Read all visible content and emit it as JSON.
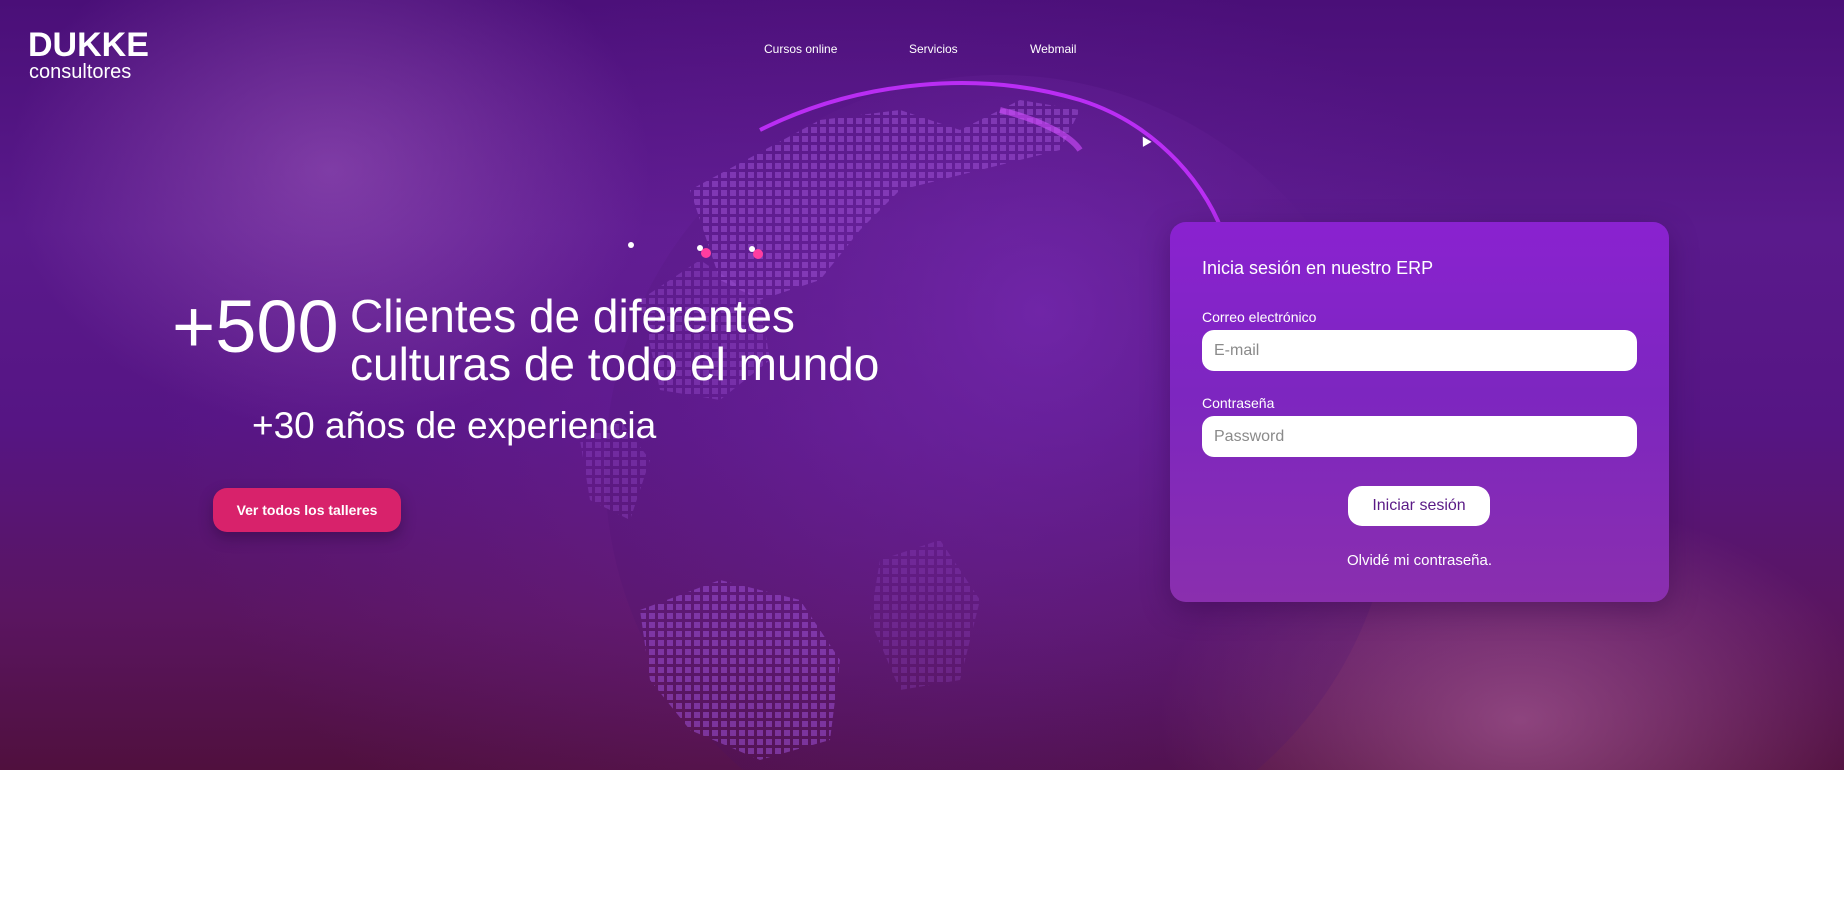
{
  "brand": {
    "line1": "DUKKE",
    "line2": "consultores"
  },
  "nav": {
    "items": [
      "Cursos online",
      "Servicios",
      "Webmail"
    ]
  },
  "hero": {
    "big_number": "+500",
    "headline_line1": "Clientes de diferentes",
    "headline_line2": "culturas de todo el mundo",
    "subline": "+30 años de experiencia",
    "cta_label": "Ver todos los talleres"
  },
  "login": {
    "title": "Inicia sesión en nuestro ERP",
    "email_label": "Correo electrónico",
    "email_placeholder": "E-mail",
    "email_value": "",
    "password_label": "Contraseña",
    "password_placeholder": "Password",
    "password_value": "",
    "submit_label": "Iniciar sesión",
    "forgot_label": "Olvidé mi contraseña."
  },
  "colors": {
    "accent_pink": "#d8226b",
    "hero_purple": "#561584",
    "card_purple": "#8a22d0",
    "globe_highlight": "#c430ff"
  }
}
